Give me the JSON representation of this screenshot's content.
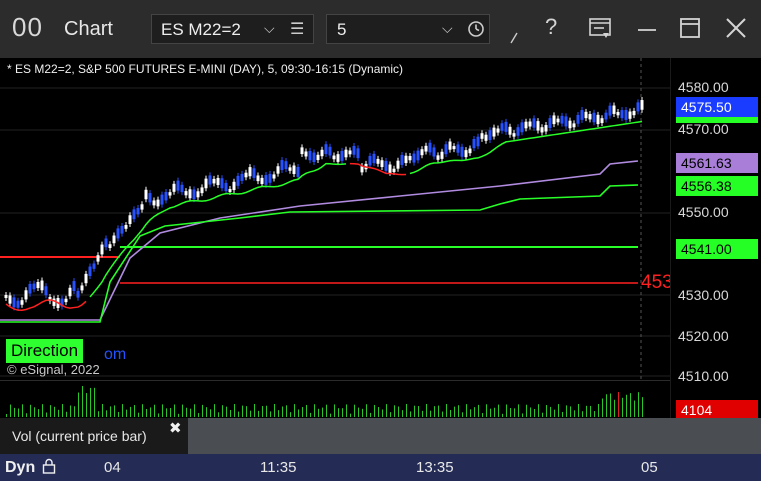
{
  "window": {
    "app_logo": "00",
    "title": "Chart",
    "symbol": "ES M22=2",
    "interval": "5"
  },
  "icons": {
    "symbol_dropdown": "chevron-down-icon",
    "symbol_list": "list-icon",
    "interval_dropdown": "chevron-down-icon",
    "interval_clock": "clock-icon",
    "draw": "pen-icon",
    "help": "question-icon",
    "layout": "layout-icon",
    "minimize": "minimize-icon",
    "maximize": "maximize-icon",
    "close": "close-icon",
    "lock": "lock-icon"
  },
  "chart": {
    "header": "* ES M22=2, S&P 500 FUTURES E-MINI (DAY), 5, 09:30-16:15 (Dynamic)",
    "direction_label": "Direction",
    "url_fragment": "om",
    "copyright": "© eSignal, 2022",
    "red_edge_label": "453",
    "price_ticks": [
      "4580.00",
      "4570.00",
      "4550.00",
      "4530.00",
      "4520.00",
      "4510.00"
    ],
    "price_tags": [
      {
        "label": "4575.50",
        "bg": "#1a3cff",
        "fg": "#ffffff"
      },
      {
        "label": "4561.63",
        "bg": "#a87ed8",
        "fg": "#000000"
      },
      {
        "label": "4556.38",
        "bg": "#25ff25",
        "fg": "#000000"
      },
      {
        "label": "4541.00",
        "bg": "#25ff25",
        "fg": "#000000"
      },
      {
        "label": "4104",
        "bg": "#e00000",
        "fg": "#ffffff"
      }
    ],
    "time_labels": [
      "04",
      "11:35",
      "13:35",
      "05"
    ],
    "dyn_label": "Dyn",
    "volume_panel_label": "Vol (current price bar)",
    "volume_close_glyph": "✖"
  },
  "colors": {
    "up_candle": "#ffffff",
    "down_candle": "#2850ff",
    "ma_fast": "#28ff28",
    "ma_slow": "#b08be0",
    "level_red": "#ff2020",
    "level_green": "#28ff28",
    "volume": "#28c828",
    "volume_red": "#e02020"
  }
}
